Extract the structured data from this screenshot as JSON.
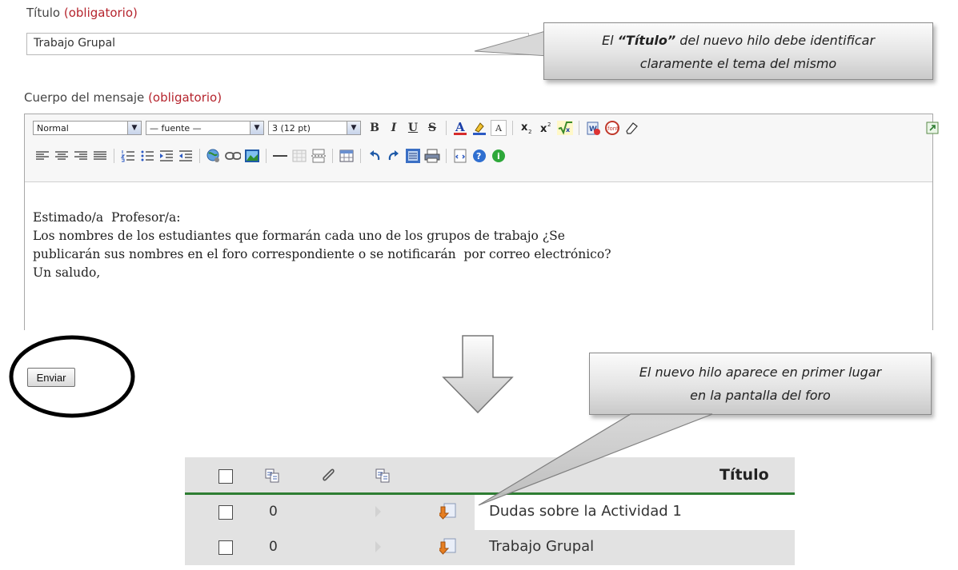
{
  "form": {
    "title_label": "Título",
    "title_required": "(obligatorio)",
    "title_value": "Trabajo Grupal",
    "body_label": "Cuerpo del mensaje",
    "body_required": "(obligatorio)"
  },
  "callouts": {
    "title_note_pre": "El ",
    "title_note_bold": "“Título”",
    "title_note_post": " del nuevo hilo debe identificar",
    "title_note_line2": "claramente el tema del mismo",
    "forum_note_line1": "El nuevo hilo aparece en primer lugar",
    "forum_note_line2": "en la pantalla del foro"
  },
  "toolbar": {
    "format_value": "Normal",
    "font_value": "— fuente —",
    "size_value": "3 (12 pt)",
    "dropdown_glyph": "▼",
    "row1_icons": [
      {
        "name": "bold-icon",
        "glyph": "B"
      },
      {
        "name": "italic-icon",
        "glyph": "I"
      },
      {
        "name": "underline-icon",
        "glyph": "U"
      },
      {
        "name": "strikethrough-icon",
        "glyph": "S"
      }
    ],
    "row2_icons": [
      "align-left-icon",
      "align-center-icon",
      "align-right-icon",
      "justify-icon",
      "ordered-list-icon",
      "unordered-list-icon",
      "indent-icon",
      "outdent-icon",
      "link-icon",
      "unlink-icon",
      "image-icon",
      "horizontal-rule-icon",
      "table-icon",
      "page-break-icon",
      "table-props-icon",
      "undo-icon",
      "redo-icon",
      "select-all-icon",
      "print-icon",
      "source-icon",
      "help-icon",
      "about-icon"
    ]
  },
  "message": {
    "line1": "Estimado/a  Profesor/a:",
    "line2": "Los nombres de los estudiantes que formarán cada uno de los grupos de trabajo ¿Se",
    "line3": "publicarán sus nombres en el foro correspondiente o se notificarán  por correo electrónico?",
    "line4": "Un saludo,"
  },
  "submit_label": "Enviar",
  "forum": {
    "header_title": "Título",
    "rows": [
      {
        "count": "0",
        "title": "Dudas sobre la Actividad  1"
      },
      {
        "count": "0",
        "title": "Trabajo Grupal"
      }
    ]
  },
  "colors": {
    "required": "#b5242d",
    "header_underline": "#2e7d32",
    "arrow_icon": "#e67e22"
  }
}
